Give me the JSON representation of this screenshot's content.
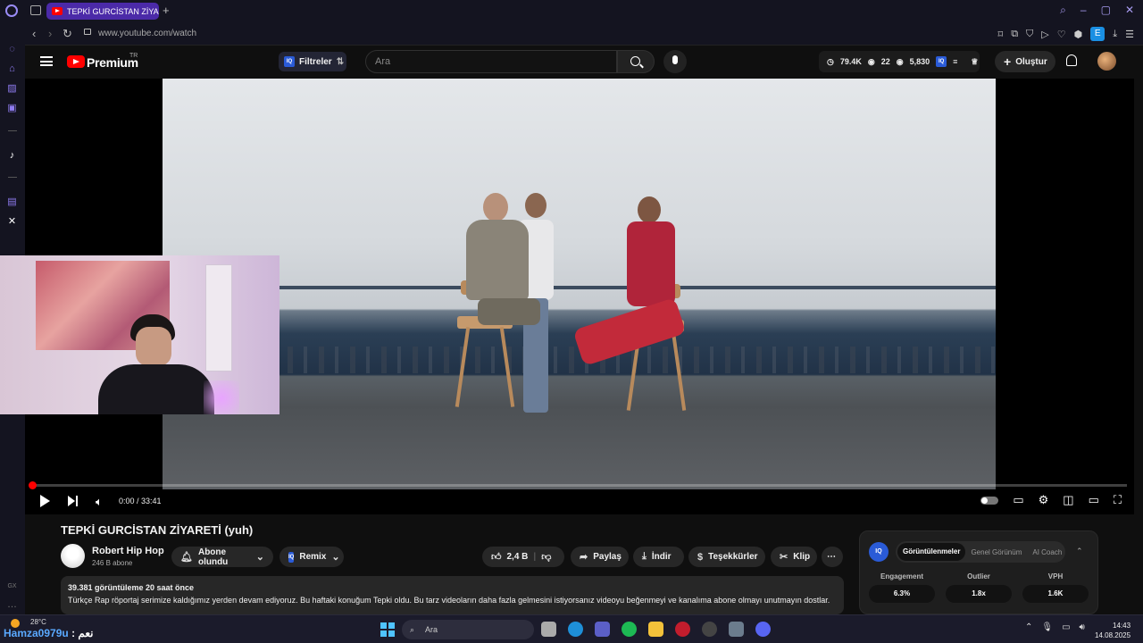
{
  "browser": {
    "tab_title": "TEPKİ GURCİSTAN ZİYARETİ (yuh) - YouTube",
    "new_tab": "+",
    "url": "www.youtube.com/watch",
    "ext_badge": "E"
  },
  "youtube": {
    "brand": "Premium",
    "brand_sup": "TR",
    "filter_label": "Filtreler",
    "search_placeholder": "Ara",
    "stats": {
      "views": "79.4K",
      "likes": "22",
      "watching": "5,830"
    },
    "create_label": "Oluştur"
  },
  "player": {
    "time": "0:00 / 33:41",
    "progress_fraction": 0.002
  },
  "video": {
    "title": "TEPKİ GURCİSTAN ZİYARETİ (yuh)",
    "channel_name": "Robert Hip Hop",
    "channel_subs": "246 B abone",
    "subscribed_label": "Abone olundu",
    "remix_label": "Remix",
    "like_count": "2,4 B",
    "share_label": "Paylaş",
    "download_label": "İndir",
    "thanks_label": "Teşekkürler",
    "clip_label": "Klip",
    "description_meta": "39.381 görüntüleme  20 saat önce",
    "description_text": "Türkçe Rap röportaj serimize kaldığımız yerden devam ediyoruz. Bu haftaki konuğum Tepki oldu. Bu tarz videoların daha fazla gelmesini istiyorsanız videoyu beğenmeyi ve kanalıma abone olmayı unutmayın dostlar."
  },
  "panel": {
    "badge": "IQ",
    "tabs": [
      "Görüntülenmeler",
      "Genel Görünüm",
      "AI Coach"
    ],
    "metrics": [
      {
        "label": "Engagement",
        "value": "6.3%"
      },
      {
        "label": "Outlier",
        "value": "1.8x"
      },
      {
        "label": "VPH",
        "value": "1.6K"
      }
    ]
  },
  "taskbar": {
    "temperature": "28°C",
    "chat_user": "Hamza0979u",
    "chat_message": ": نعم",
    "search_label": "Ara",
    "time": "14:43",
    "date": "14.08.2025"
  },
  "sidebar_icons": [
    "aria-icon",
    "bag-icon",
    "tabs-icon",
    "m-icon",
    "tiktok-icon",
    "twitch-icon",
    "x-icon",
    "gx-icon"
  ],
  "colors": {
    "youtube_red": "#ff0000",
    "opera_accent": "#9a8cf5",
    "tab_active": "#4b2aa8"
  }
}
